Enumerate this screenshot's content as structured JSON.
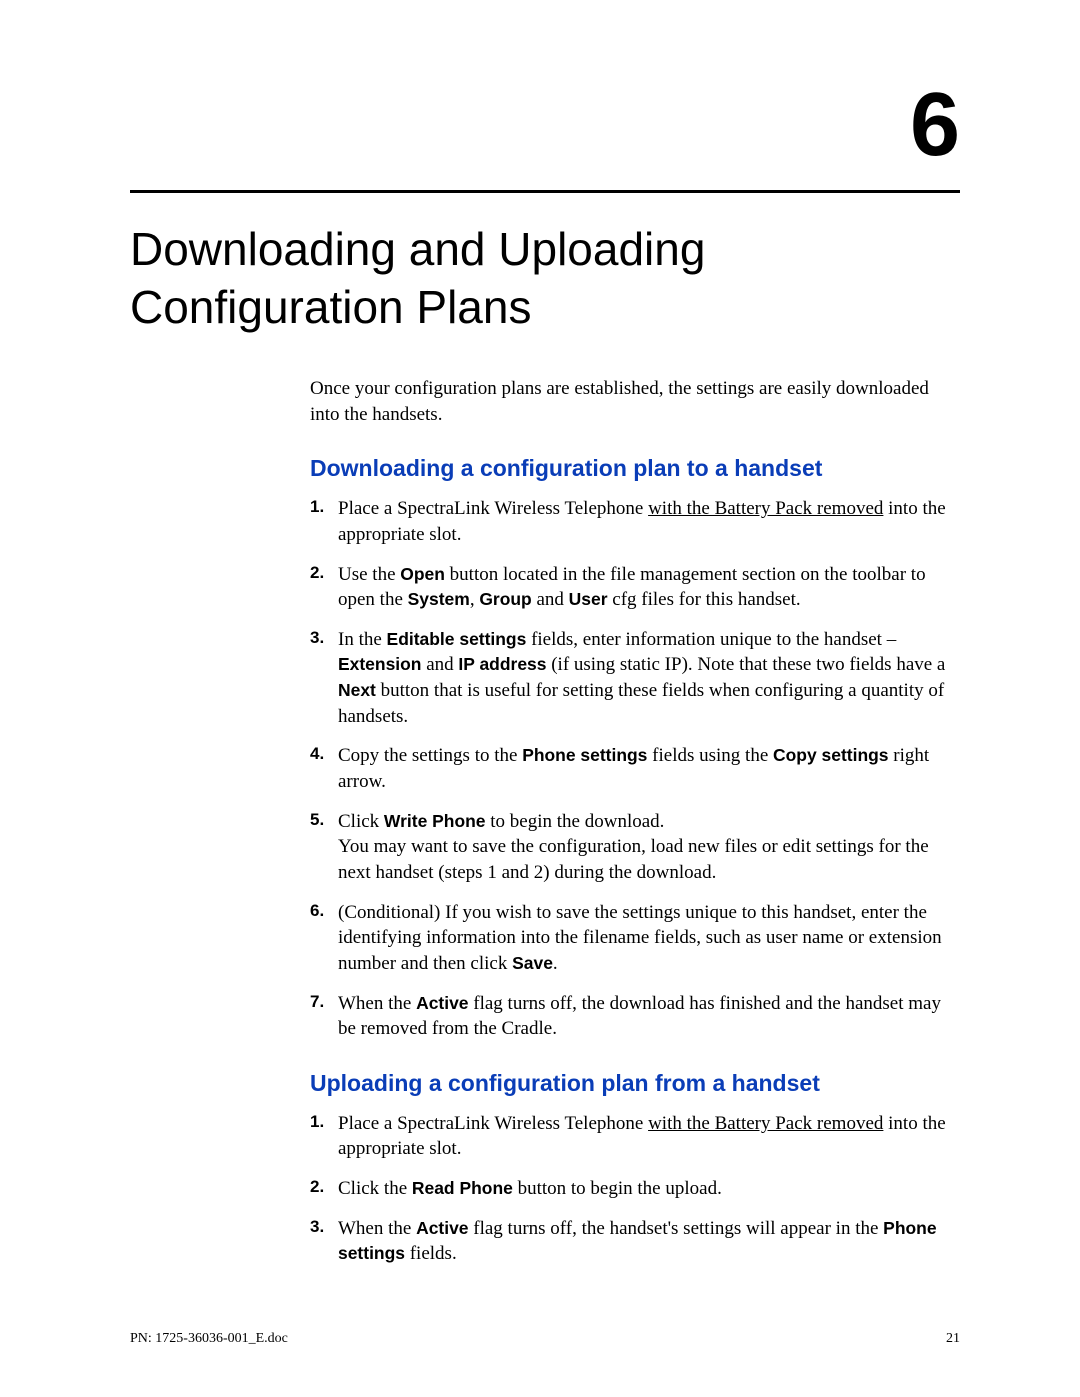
{
  "chapter_number": "6",
  "chapter_title": "Downloading and Uploading Configuration Plans",
  "intro": "Once your configuration plans are established, the settings are easily downloaded into the handsets.",
  "section_a": {
    "heading": "Downloading a configuration plan to a handset",
    "steps": {
      "s1a": "Place a SpectraLink Wireless Telephone ",
      "s1b": "with the Battery Pack removed",
      "s1c": " into the appropriate slot.",
      "s2a": "Use the ",
      "s2_open": "Open",
      "s2b": " button located in the file management section on the toolbar to open the ",
      "s2_system": "System",
      "s2c": ", ",
      "s2_group": "Group",
      "s2d": " and ",
      "s2_user": "User",
      "s2e": " cfg files for this handset.",
      "s3a": "In the ",
      "s3_edit": "Editable settings",
      "s3b": " fields, enter information unique to the handset – ",
      "s3_ext": "Extension",
      "s3c": " and ",
      "s3_ip": "IP address",
      "s3d": " (if using static IP). Note that these two fields have a ",
      "s3_next": "Next",
      "s3e": " button that is useful for setting these fields when configuring a quantity of handsets.",
      "s4a": "Copy the settings to the ",
      "s4_phone": "Phone settings",
      "s4b": " fields using the ",
      "s4_copy": "Copy settings",
      "s4c": " right arrow.",
      "s5a": "Click ",
      "s5_write": "Write Phone",
      "s5b": " to begin the download.",
      "s5c": "You may want to save the configuration, load new files or edit settings for the next handset (steps 1 and 2) during the download.",
      "s6a": "(Conditional) If you wish to save the settings unique to this handset, enter the identifying information into the filename fields, such as user name or extension number and then click ",
      "s6_save": "Save",
      "s6b": ".",
      "s7a": "When the ",
      "s7_active": "Active",
      "s7b": " flag turns off, the download has finished and the handset may be removed from the Cradle."
    }
  },
  "section_b": {
    "heading": "Uploading a configuration plan from a handset",
    "steps": {
      "s1a": "Place a SpectraLink Wireless Telephone ",
      "s1b": "with the Battery Pack removed",
      "s1c": " into the appropriate slot.",
      "s2a": "Click the ",
      "s2_read": "Read Phone",
      "s2b": " button to begin the upload.",
      "s3a": "When the ",
      "s3_active": "Active",
      "s3b": " flag turns off, the handset's settings will appear in the ",
      "s3_phone": "Phone settings",
      "s3c": " fields."
    }
  },
  "footer": {
    "left": "PN: 1725-36036-001_E.doc",
    "right": "21"
  }
}
